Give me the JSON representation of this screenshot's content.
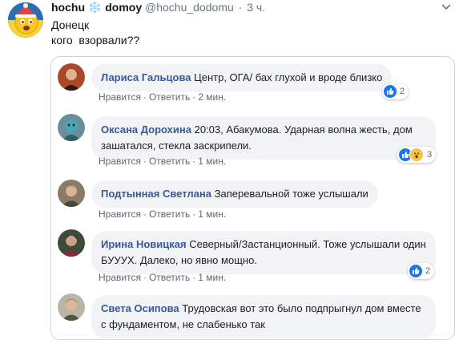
{
  "tweet": {
    "display_name": "hochu",
    "name_emoji": "❄️",
    "name_suffix": "domoy",
    "handle": "@hochu_dodomu",
    "separator": "·",
    "time": "3 ч.",
    "text": "Донецк\nкого  взорвали??"
  },
  "comments": [
    {
      "author": "Лариса Гальцова",
      "text": "Центр, ОГА/ бах глухой и вроде близко",
      "like_label": "Нравится",
      "reply_label": "Ответить",
      "time": "2 мин.",
      "reaction_count": "2",
      "reactions": [
        "like-icon"
      ]
    },
    {
      "author": "Оксана Дорохина",
      "text": "20:03, Абакумова. Ударная волна жесть, дом зашатался, стекла заскрипели.",
      "like_label": "Нравится",
      "reply_label": "Ответить",
      "time": "1 мин.",
      "reaction_count": "3",
      "reactions": [
        "like-icon",
        "wow-icon"
      ]
    },
    {
      "author": "Подтынная Светлана",
      "text": "Заперевальной тоже услышали",
      "like_label": "Нравится",
      "reply_label": "Ответить",
      "time": "1 мин."
    },
    {
      "author": "Ирина Новицкая",
      "text": "Северный/Застанционный. Тоже услышали один БУУУХ. Далеко, но явно мощно.",
      "like_label": "Нравится",
      "reply_label": "Ответить",
      "time": "1 мин.",
      "reaction_count": "2",
      "reactions": [
        "like-icon"
      ]
    },
    {
      "author": "Света Осипова",
      "text": "Трудовская вот это было подпрыгнул дом вместе с фундаментом, не слабенько так"
    }
  ],
  "colors": {
    "facebook_link": "#385898",
    "bubble": "#f2f3f5",
    "like_blue": "#1877f2",
    "wow_yellow": "#f7c342",
    "twitter_gray": "#657786"
  }
}
